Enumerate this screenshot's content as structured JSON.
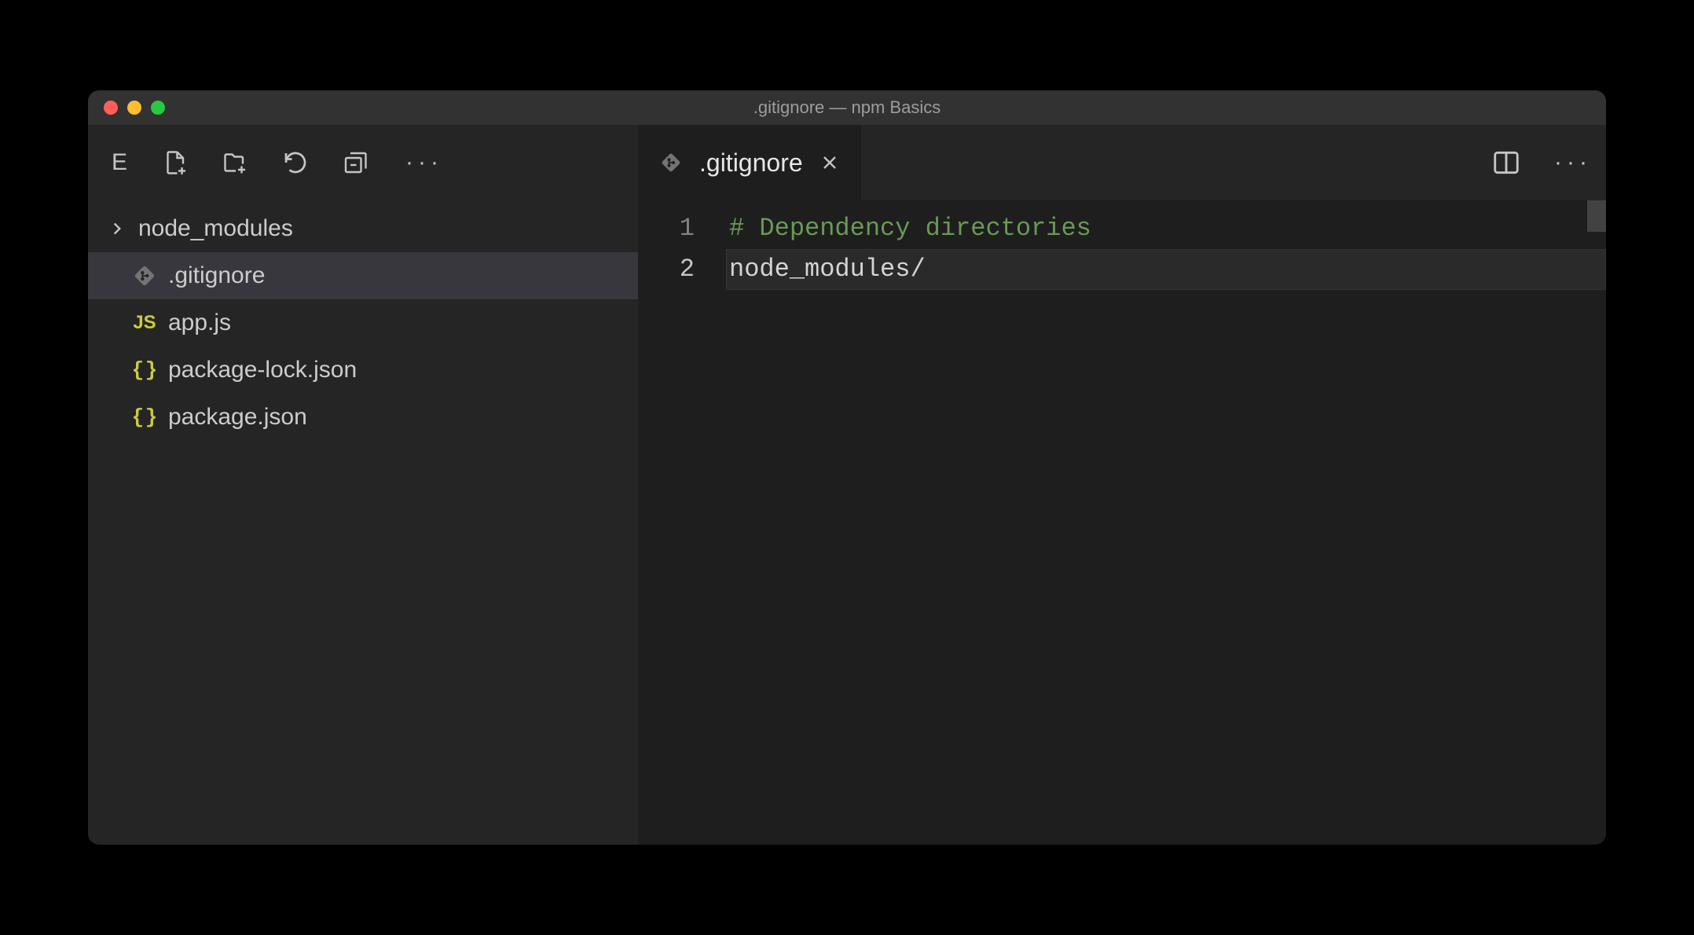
{
  "window": {
    "title": ".gitignore — npm Basics"
  },
  "explorer": {
    "header_letter": "E",
    "items": [
      {
        "icon": "chevron",
        "label": "node_modules",
        "type": "folder"
      },
      {
        "icon": "git",
        "label": ".gitignore",
        "type": "file",
        "selected": true
      },
      {
        "icon": "js",
        "label": "app.js",
        "type": "file"
      },
      {
        "icon": "json",
        "label": "package-lock.json",
        "type": "file"
      },
      {
        "icon": "json",
        "label": "package.json",
        "type": "file"
      }
    ]
  },
  "tabs": {
    "active": {
      "label": ".gitignore",
      "icon": "git"
    }
  },
  "editor": {
    "lines": [
      {
        "num": "1",
        "content": "# Dependency directories",
        "type": "comment"
      },
      {
        "num": "2",
        "content": "node_modules/",
        "type": "plain",
        "current": true
      }
    ]
  }
}
